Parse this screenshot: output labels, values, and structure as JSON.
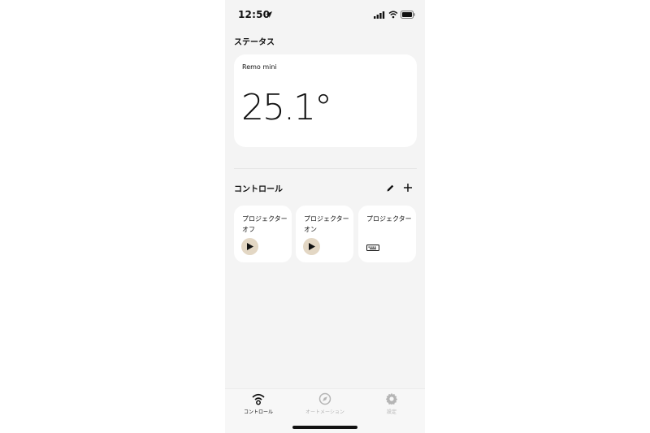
{
  "status_bar": {
    "time": "12:50",
    "icons": [
      "location-arrow-icon",
      "cellular-signal-icon",
      "wifi-icon",
      "battery-icon"
    ]
  },
  "status_section": {
    "title": "ステータス",
    "card": {
      "device_name": "Remo mini",
      "temperature": "25.1°"
    }
  },
  "control_section": {
    "title": "コントロール",
    "actions": [
      "edit-icon",
      "add-icon"
    ],
    "items": [
      {
        "label": "プロジェクターオフ",
        "icon": "play-icon"
      },
      {
        "label": "プロジェクターオン",
        "icon": "play-icon"
      },
      {
        "label": "プロジェクター",
        "icon": "remote-keyboard-icon"
      }
    ]
  },
  "tab_bar": {
    "tabs": [
      {
        "label": "コントロール",
        "icon": "wifi-remote-icon",
        "active": true
      },
      {
        "label": "オートメーション",
        "icon": "compass-icon",
        "active": false
      },
      {
        "label": "設定",
        "icon": "gear-icon",
        "active": false
      }
    ]
  },
  "colors": {
    "background": "#f4f4f4",
    "card": "#ffffff",
    "play_button": "#e3d7c4",
    "inactive_tab": "#b5b5b5"
  }
}
